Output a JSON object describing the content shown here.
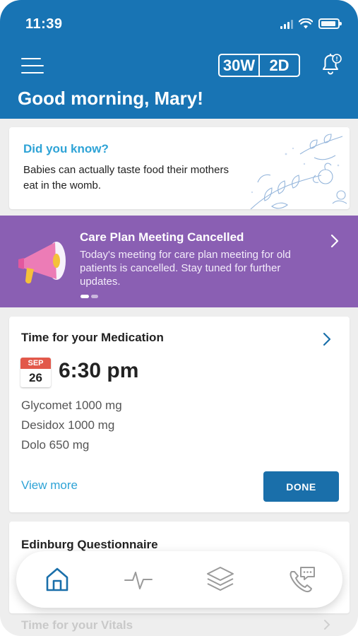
{
  "status_bar": {
    "time": "11:39"
  },
  "header": {
    "weeks": "30W",
    "days": "2D",
    "greeting": "Good morning, Mary!",
    "bell_badge": "!"
  },
  "did_you_know": {
    "title": "Did you know?",
    "text": "Babies can actually taste food their mothers eat in the womb."
  },
  "announcement": {
    "title": "Care Plan Meeting Cancelled",
    "text": "Today's meeting for care plan meeting for old patients is cancelled. Stay tuned for further updates."
  },
  "medication": {
    "title": "Time for your Medication",
    "month": "SEP",
    "day": "26",
    "time": "6:30 pm",
    "items": [
      "Glycomet 1000 mg",
      "Desidox 1000 mg",
      "Dolo 650 mg"
    ],
    "view_more": "View more",
    "done": "DONE"
  },
  "edinburg": {
    "title": "Edinburg Questionnaire"
  },
  "vitals": {
    "title": "Time for your Vitals"
  },
  "bottom_nav": [
    {
      "icon": "home-icon",
      "active": true
    },
    {
      "icon": "pulse-icon",
      "active": false
    },
    {
      "icon": "layers-icon",
      "active": false
    },
    {
      "icon": "phone-chat-icon",
      "active": false
    }
  ],
  "colors": {
    "header": "#1874b4",
    "accent": "#2ea3d6",
    "banner": "#8a5fb3",
    "done_button": "#1a6faa",
    "calendar_month": "#e2584a"
  }
}
